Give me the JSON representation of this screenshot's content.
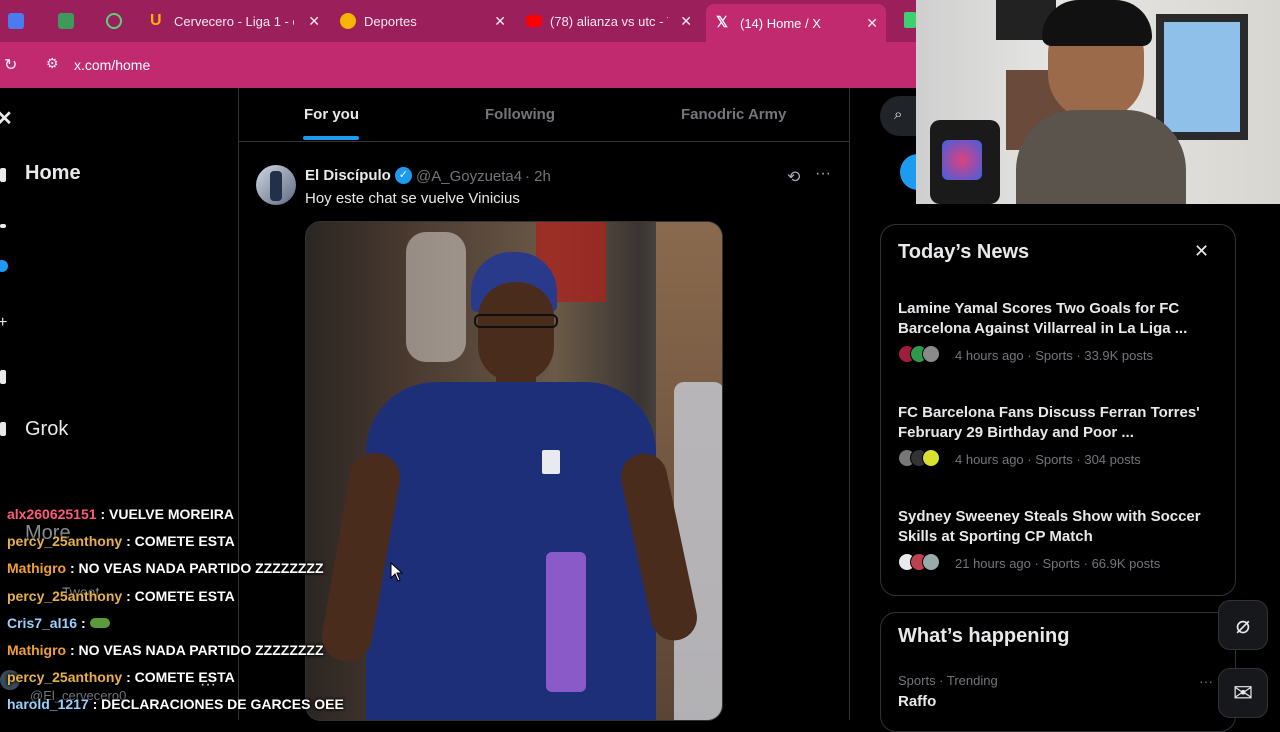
{
  "tabs": [
    {
      "label": "",
      "icon": "docs-icon"
    },
    {
      "label": "",
      "icon": "extension-icon"
    },
    {
      "label": "",
      "icon": "whatsapp-icon"
    },
    {
      "label": "Cervecero - Liga 1 - c",
      "icon": "u-brand-icon"
    },
    {
      "label": "Deportes",
      "icon": "sports-icon"
    },
    {
      "label": "(78) alianza vs utc - Y",
      "icon": "youtube-icon"
    },
    {
      "label": "(14) Home / X",
      "icon": "x-logo-icon"
    }
  ],
  "address": {
    "url": "x.com/home"
  },
  "nav": {
    "home": "Home",
    "grok": "Grok",
    "more": "More",
    "post": "Tweet"
  },
  "feed_tabs": [
    "For you",
    "Following",
    "Fanodric Army"
  ],
  "post": {
    "author": "El Discípulo",
    "handle": "@A_Goyzueta4",
    "time": "· 2h",
    "text": "Hoy este chat se vuelve Vinicius"
  },
  "news": {
    "heading": "Today’s News",
    "items": [
      {
        "title": "Lamine Yamal Scores Two Goals for FC Barcelona Against Villarreal in La Liga ...",
        "meta": "4 hours ago · Sports · 33.9K posts"
      },
      {
        "title": "FC Barcelona Fans Discuss Ferran Torres' February 29 Birthday and Poor ...",
        "meta": "4 hours ago · Sports · 304 posts"
      },
      {
        "title": "Sydney Sweeney Steals Show with Soccer Skills at Sporting CP Match",
        "meta": "21 hours ago · Sports · 66.9K posts"
      }
    ]
  },
  "happening": {
    "heading": "What’s happening",
    "category": "Sports · Trending",
    "topic": "Raffo"
  },
  "user": {
    "handle": "@El_cervecero0"
  },
  "chat": [
    {
      "user": "alx260625151",
      "msg": ": VUELVE MOREIRA",
      "color": "#ff5a7a"
    },
    {
      "user": "percy_25anthony",
      "msg": ": COMETE ESTA",
      "color": "#e8b04a"
    },
    {
      "user": "Mathigro",
      "msg": ": NO VEAS NADA PARTIDO ZZZZZZZZ",
      "color": "#f0a030"
    },
    {
      "user": "percy_25anthony",
      "msg": ": COMETE ESTA",
      "color": "#e8b04a"
    },
    {
      "user": "Cris7_al16",
      "msg": ":",
      "color": "#9ad0ff"
    },
    {
      "user": "Mathigro",
      "msg": ": NO VEAS NADA PARTIDO ZZZZZZZZ",
      "color": "#f0a030"
    },
    {
      "user": "percy_25anthony",
      "msg": ": COMETE ESTA",
      "color": "#e8b04a"
    },
    {
      "user": "harold_1217",
      "msg": ": DECLARACIONES DE GARCES OEE",
      "color": "#9ad0ff"
    }
  ],
  "colors": {
    "chrome": "#9a1f5a",
    "active_tab": "#c22a70",
    "x_blue": "#1d9bf0"
  }
}
